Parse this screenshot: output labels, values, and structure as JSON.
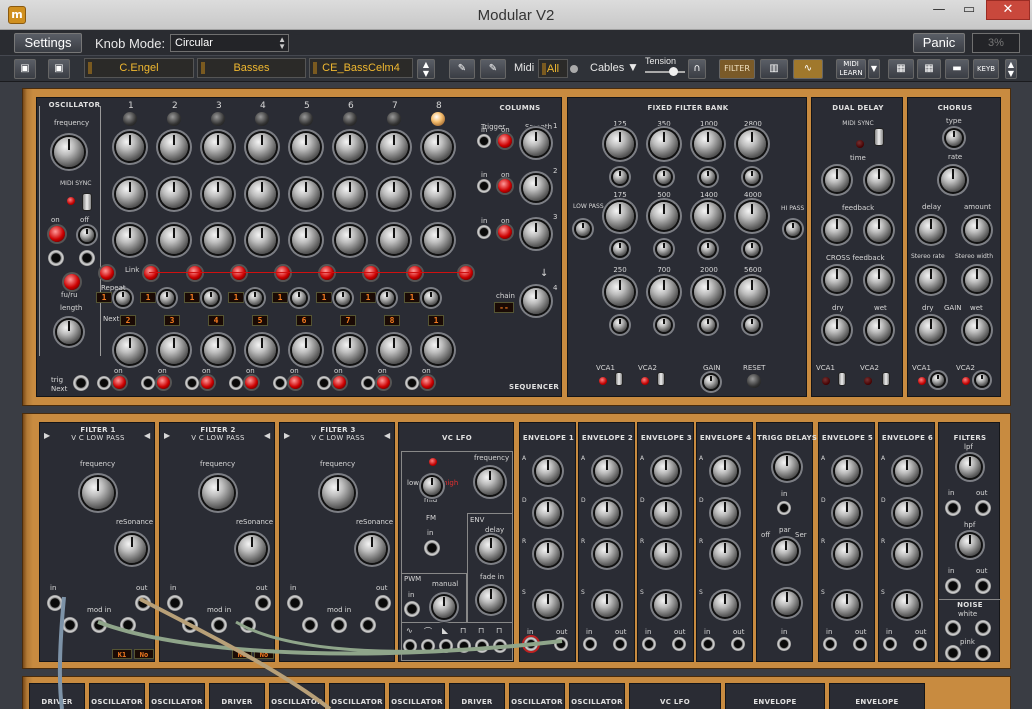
{
  "window": {
    "title": "Modular V2",
    "app_icon": "m",
    "minimize": "—",
    "maximize": "▭",
    "close": "✕"
  },
  "toolbar1": {
    "settings": "Settings",
    "knob_mode_label": "Knob Mode:",
    "knob_mode_value": "Circular",
    "panic": "Panic",
    "cpu": "3%"
  },
  "toolbar2": {
    "preset_author": "C.Engel",
    "preset_category": "Basses",
    "preset_name": "CE_BassCelm4",
    "midi_label": "Midi",
    "midi_channel": "All",
    "cables_label": "Cables",
    "tension_label": "Tension",
    "filter_label": "FILTER",
    "midi_learn_line1": "MIDI",
    "midi_learn_line2": "LEARN",
    "keyb_label": "KEYB"
  },
  "top_rack": {
    "oscillator": {
      "header": "OSCILLATOR",
      "frequency": "frequency",
      "midi_sync": "MIDI SYNC",
      "on": "on",
      "off": "off",
      "fu_ru": "fu/ru",
      "length": "length",
      "trig": "trig",
      "next": "Next"
    },
    "sequencer": {
      "columns_header": "COLUMNS",
      "footer": "SEQUENCER",
      "step_numbers": [
        "1",
        "2",
        "3",
        "4",
        "5",
        "6",
        "7",
        "8"
      ],
      "link_label": "Link",
      "repeat_label": "Repeat",
      "next_label": "Next",
      "repeat_values": [
        "1",
        "1",
        "1",
        "1",
        "1",
        "1",
        "1",
        "1"
      ],
      "next_values": [
        "2",
        "3",
        "4",
        "5",
        "6",
        "7",
        "8",
        "1"
      ],
      "trigger": "Trigger",
      "smooth": "Smooth",
      "in": "in",
      "on": "on",
      "chain": "chain",
      "row_numbers": [
        "1",
        "2",
        "3",
        "4"
      ]
    },
    "fixed_filter_bank": {
      "header": "FIXED FILTER BANK",
      "freqs_row1": [
        "125",
        "350",
        "1000",
        "2800"
      ],
      "freqs_row2": [
        "175",
        "500",
        "1400",
        "4000"
      ],
      "freqs_row3": [
        "250",
        "700",
        "2000",
        "5600"
      ],
      "low_pass": "LOW PASS",
      "hi_pass": "HI PASS",
      "vca1": "VCA1",
      "vca2": "VCA2",
      "gain": "GAIN",
      "reset": "RESET"
    },
    "dual_delay": {
      "header": "DUAL DELAY",
      "midi_sync": "MIDI SYNC",
      "time": "time",
      "feedback": "feedback",
      "cross_feedback": "CROSS feedback",
      "dry": "dry",
      "wet": "wet",
      "vca1": "VCA1",
      "vca2": "VCA2"
    },
    "chorus": {
      "header": "CHORUS",
      "type": "type",
      "rate": "rate",
      "delay": "delay",
      "amount": "amount",
      "stereo_rate": "Stereo rate",
      "stereo_width": "Stereo width",
      "dry": "dry",
      "gain": "GAIN",
      "wet": "wet",
      "vca1": "VCA1",
      "vca2": "VCA2"
    }
  },
  "bottom_rack": {
    "filters": [
      {
        "header": "FILTER 1",
        "type": "V C LOW PASS",
        "frequency": "frequency",
        "resonance": "reSonance",
        "in": "in",
        "out": "out",
        "mod_in": "mod in",
        "key": "K1",
        "key2": "No"
      },
      {
        "header": "FILTER 2",
        "type": "V C LOW PASS",
        "frequency": "frequency",
        "resonance": "reSonance",
        "in": "in",
        "out": "out",
        "mod_in": "mod in",
        "key": "No",
        "key2": "No"
      },
      {
        "header": "FILTER 3",
        "type": "V C LOW PASS",
        "frequency": "frequency",
        "resonance": "reSonance",
        "in": "in",
        "out": "out",
        "mod_in": "mod in",
        "key": "",
        "key2": ""
      }
    ],
    "vc_lfo": {
      "header": "VC LFO",
      "frequency": "frequency",
      "low": "low",
      "mid": "mid",
      "high": "high",
      "fm": "FM",
      "in": "in",
      "env": "ENV",
      "delay": "delay",
      "fade_in": "fade in",
      "pwm": "PWM",
      "manual": "manual"
    },
    "envelopes": [
      {
        "header": "ENVELOPE 1"
      },
      {
        "header": "ENVELOPE 2"
      },
      {
        "header": "ENVELOPE 3"
      },
      {
        "header": "ENVELOPE 4"
      },
      {
        "header": "TRIGG DELAYS"
      },
      {
        "header": "ENVELOPE 5"
      },
      {
        "header": "ENVELOPE 6"
      }
    ],
    "env_letters": [
      "A",
      "D",
      "R",
      "S"
    ],
    "trigg": {
      "in": "in",
      "off": "off",
      "par": "par",
      "ser": "Ser"
    },
    "filters_panel": {
      "header": "FILTERS",
      "lpf": "lpf",
      "hpf": "hpf",
      "in": "in",
      "out": "out",
      "noise": "NOISE",
      "white": "white",
      "pink": "pink"
    },
    "env_in": "in",
    "env_out": "out"
  },
  "third_rack": {
    "labels": [
      "DRIVER",
      "OSCILLATOR",
      "OSCILLATOR",
      "DRIVER",
      "OSCILLATOR",
      "OSCILLATOR",
      "OSCILLATOR",
      "DRIVER",
      "OSCILLATOR",
      "OSCILLATOR",
      "VC LFO",
      "ENVELOPE",
      "ENVELOPE"
    ]
  },
  "colors": {
    "wood": "#c88b40",
    "panel": "#2a2c34",
    "led": "#e01010",
    "display": "#f57a20",
    "preset_text": "#f0b830"
  }
}
